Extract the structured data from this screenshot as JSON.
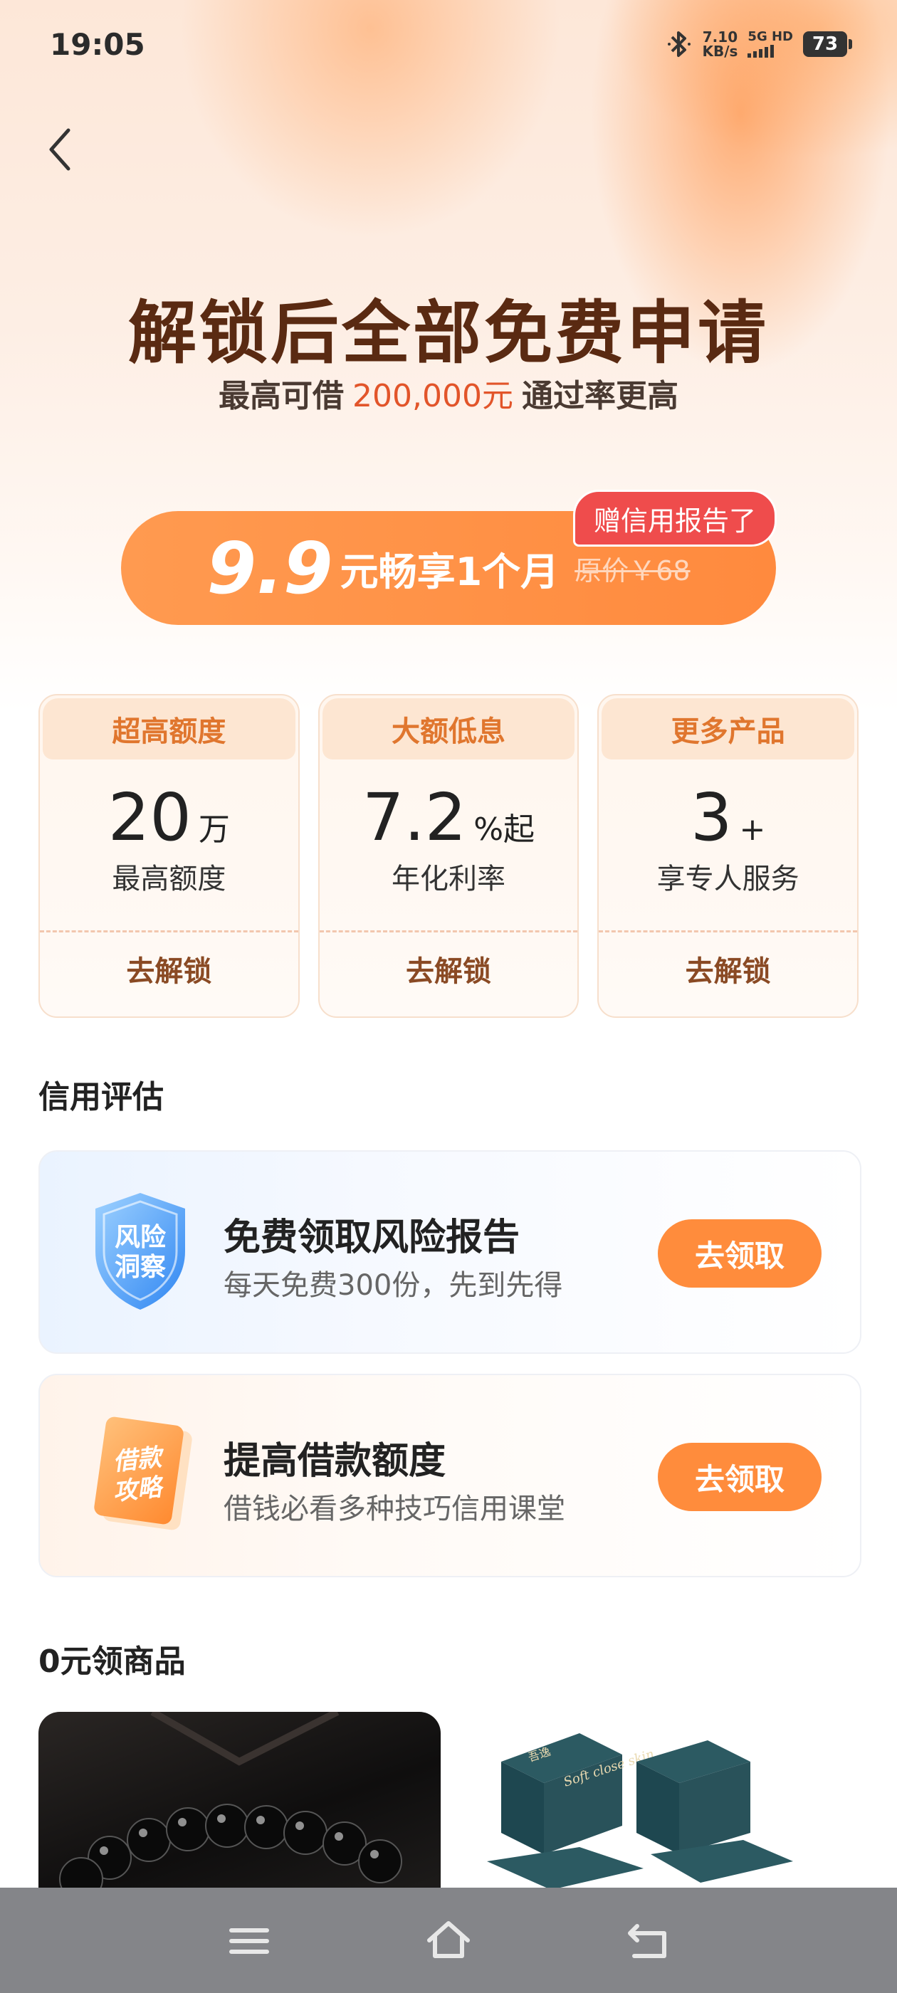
{
  "status_bar": {
    "time": "19:05",
    "net_speed_value": "7.10",
    "net_speed_unit": "KB/s",
    "network": "5G HD",
    "battery": "73"
  },
  "hero": {
    "headline": "解锁后全部免费申请",
    "sub_prefix": "最高可借",
    "sub_amount": "200,000元",
    "sub_suffix": "通过率更高"
  },
  "cta": {
    "price": "9.9",
    "text": "元畅享1个月",
    "original_price": "原价￥68",
    "badge": "赠信用报告了"
  },
  "benefit_cards": [
    {
      "title": "超高额度",
      "value": "20",
      "unit": "万",
      "label": "最高额度",
      "action": "去解锁"
    },
    {
      "title": "大额低息",
      "value": "7.2",
      "unit": "%起",
      "label": "年化利率",
      "action": "去解锁"
    },
    {
      "title": "更多产品",
      "value": "3",
      "unit": "+",
      "label": "享专人服务",
      "action": "去解锁"
    }
  ],
  "credit_section": {
    "title": "信用评估",
    "items": [
      {
        "icon_text_1": "风险",
        "icon_text_2": "洞察",
        "title": "免费领取风险报告",
        "subtitle": "每天免费300份，先到先得",
        "button": "去领取"
      },
      {
        "icon_text_1": "借款",
        "icon_text_2": "攻略",
        "title": "提高借款额度",
        "subtitle": "借钱必看多种技巧信用课堂",
        "button": "去领取"
      }
    ]
  },
  "goods_section": {
    "title": "0元领商品",
    "product_2_text": "Soft close skin",
    "product_2_brand": "吾逸"
  },
  "colors": {
    "accent_orange": "#ff8c3c",
    "headline_brown": "#5a2a12",
    "amount_red": "#e2552a",
    "badge_red": "#ef4c4c"
  },
  "icons": [
    "bluetooth-icon",
    "back-arrow-icon",
    "shield-icon",
    "book-icon",
    "menu-icon",
    "home-icon",
    "return-icon"
  ]
}
